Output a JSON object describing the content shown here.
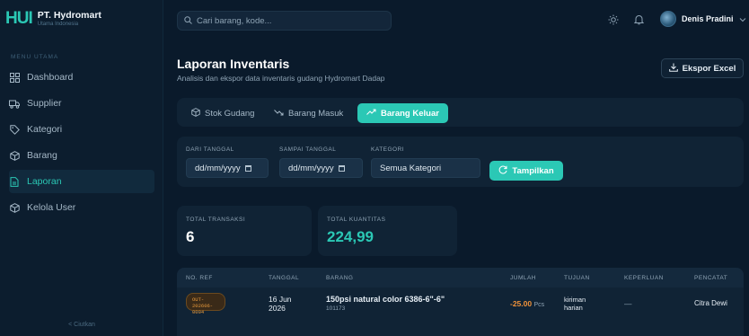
{
  "brand": {
    "logo": "HUI",
    "name": "PT. Hydromart",
    "subtitle": "Utama Indonesia"
  },
  "sidebar": {
    "section_label": "MENU UTAMA",
    "items": [
      {
        "label": "Dashboard",
        "icon": "grid-icon"
      },
      {
        "label": "Supplier",
        "icon": "truck-icon"
      },
      {
        "label": "Kategori",
        "icon": "tag-icon"
      },
      {
        "label": "Barang",
        "icon": "box-icon"
      },
      {
        "label": "Laporan",
        "icon": "document-icon",
        "active": true
      },
      {
        "label": "Kelola User",
        "icon": "box-icon"
      }
    ],
    "collapse_label": "<  Ciutkan"
  },
  "topbar": {
    "search_placeholder": "Cari barang, kode...",
    "user_name": "Denis Pradini"
  },
  "page": {
    "title": "Laporan Inventaris",
    "subtitle": "Analisis dan ekspor data inventaris gudang Hydromart Dadap",
    "export_label": "Ekspor Excel"
  },
  "tabs": [
    {
      "label": "Stok Gudang",
      "icon": "box-icon"
    },
    {
      "label": "Barang Masuk",
      "icon": "trend-down-icon"
    },
    {
      "label": "Barang Keluar",
      "icon": "trend-up-icon",
      "active": true
    }
  ],
  "filter": {
    "from_label": "DARI TANGGAL",
    "from_value": "dd/mm/yyyy",
    "to_label": "SAMPAI TANGGAL",
    "to_value": "dd/mm/yyyy",
    "category_label": "KATEGORI",
    "category_value": "Semua Kategori",
    "show_label": "Tampilkan"
  },
  "stats": {
    "total_transaksi_label": "TOTAL TRANSAKSI",
    "total_transaksi_value": "6",
    "total_kuantitas_label": "TOTAL KUANTITAS",
    "total_kuantitas_value": "224,99"
  },
  "table": {
    "columns": [
      "NO. REF",
      "TANGGAL",
      "BARANG",
      "JUMLAH",
      "TUJUAN",
      "KEPERLUAN",
      "PENCATAT"
    ],
    "rows": [
      {
        "ref_line1": "OUT-202606-",
        "ref_line2": "0004",
        "date_line1": "16 Jun",
        "date_line2": "2026",
        "item_name": "150psi natural color 6386-6\"-6\"",
        "item_code": "101173",
        "qty": "-25.00",
        "unit": "Pcs",
        "dest_line1": "kiriman",
        "dest_line2": "harian",
        "purpose": "—",
        "recorder": "Citra Dewi"
      }
    ]
  },
  "colors": {
    "accent": "#2bc8b5",
    "background": "#0a1a2b",
    "negative": "#f0923a"
  }
}
